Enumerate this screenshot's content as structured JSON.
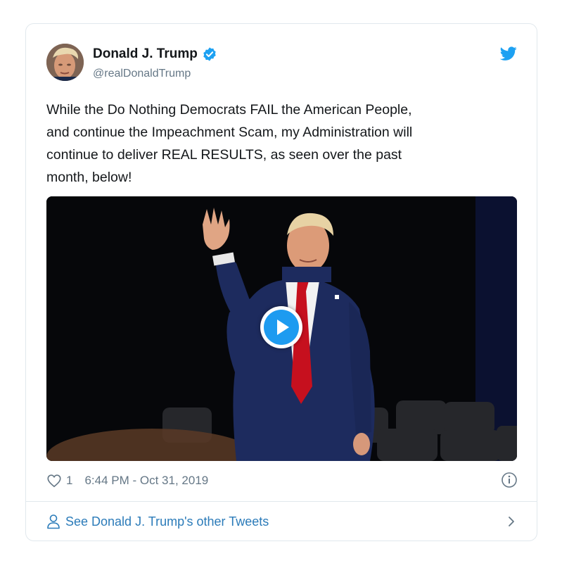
{
  "tweet": {
    "author_name": "Donald J. Trump",
    "handle": "@realDonaldTrump",
    "text_lines": [
      "While the Do Nothing Democrats FAIL the American People,",
      "and continue the Impeachment Scam, my Administration will",
      "continue to deliver REAL RESULTS, as seen over the past",
      "month, below!"
    ],
    "like_count": "1",
    "timestamp": "6:44 PM - Oct 31, 2019"
  },
  "footer": {
    "link_label": "See Donald J. Trump's other Tweets"
  },
  "icons": {
    "verified": "verified-badge-icon",
    "brand": "twitter-bird-icon",
    "like": "heart-icon",
    "info": "info-icon",
    "profile": "person-icon",
    "more": "chevron-right-icon",
    "play": "play-icon"
  },
  "colors": {
    "brand_blue": "#1da1f2",
    "link_blue": "#2b7bb9",
    "secondary_text": "#657786",
    "border": "#e1e8ed"
  }
}
